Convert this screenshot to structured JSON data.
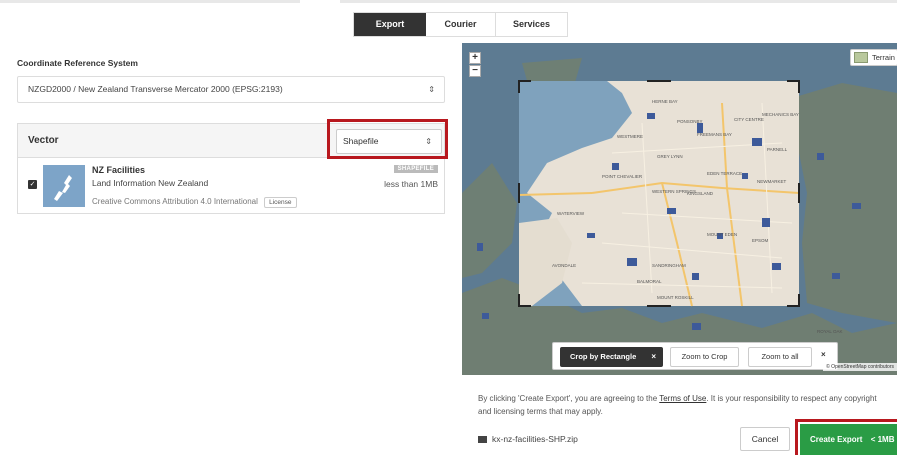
{
  "tabs": [
    {
      "label": "Export",
      "active": true
    },
    {
      "label": "Courier",
      "active": false
    },
    {
      "label": "Services",
      "active": false
    }
  ],
  "crs": {
    "label": "Coordinate Reference System",
    "value": "NZGD2000 / New Zealand Transverse Mercator 2000 (EPSG:2193)"
  },
  "vector": {
    "title": "Vector",
    "format": "Shapefile",
    "layer": {
      "checked": true,
      "name": "NZ Facilities",
      "organisation": "Land Information New Zealand",
      "license_text": "Creative Commons Attribution 4.0 International",
      "license_button": "License",
      "badge": "SHAPEFILE",
      "size": "less than 1MB"
    }
  },
  "map": {
    "zoom_in": "+",
    "zoom_out": "−",
    "basemap": "Terrain",
    "tools": {
      "crop": "Crop by Rectangle",
      "crop_close": "×",
      "zoom_crop": "Zoom to Crop",
      "zoom_all": "Zoom to all",
      "close": "×"
    },
    "attribution": "© OpenStreetMap contributors",
    "labels": [
      "HERNE BAY",
      "PONSONBY",
      "CITY CENTRE",
      "MECHANICS BAY",
      "FREEMANS BAY",
      "PARNELL",
      "WESTMERE",
      "GREY LYNN",
      "POINT CHEVALIER",
      "EDEN TERRACE",
      "NEWMARKET",
      "WESTERN SPRINGS",
      "KINGSLAND",
      "WATERVIEW",
      "MOUNT EDEN",
      "EPSOM",
      "SANDRINGHAM",
      "AVONDALE",
      "BALMORAL",
      "MOUNT ROSKILL",
      "HERNE BAY",
      "KOHIMARAMA",
      "ROYAL OAK"
    ]
  },
  "footer": {
    "agree_pre": "By clicking 'Create Export', you are agreeing to the ",
    "terms_link": "Terms of Use",
    "agree_post": ". It is your responsibility to respect any copyright and licensing terms that may apply.",
    "filename": "kx-nz-facilities-SHP.zip",
    "cancel": "Cancel",
    "create": "Create Export",
    "create_size": "< 1MB"
  },
  "colors": {
    "highlight": "#b8181e",
    "create_button": "#2a9c45",
    "active_tab": "#333333"
  }
}
